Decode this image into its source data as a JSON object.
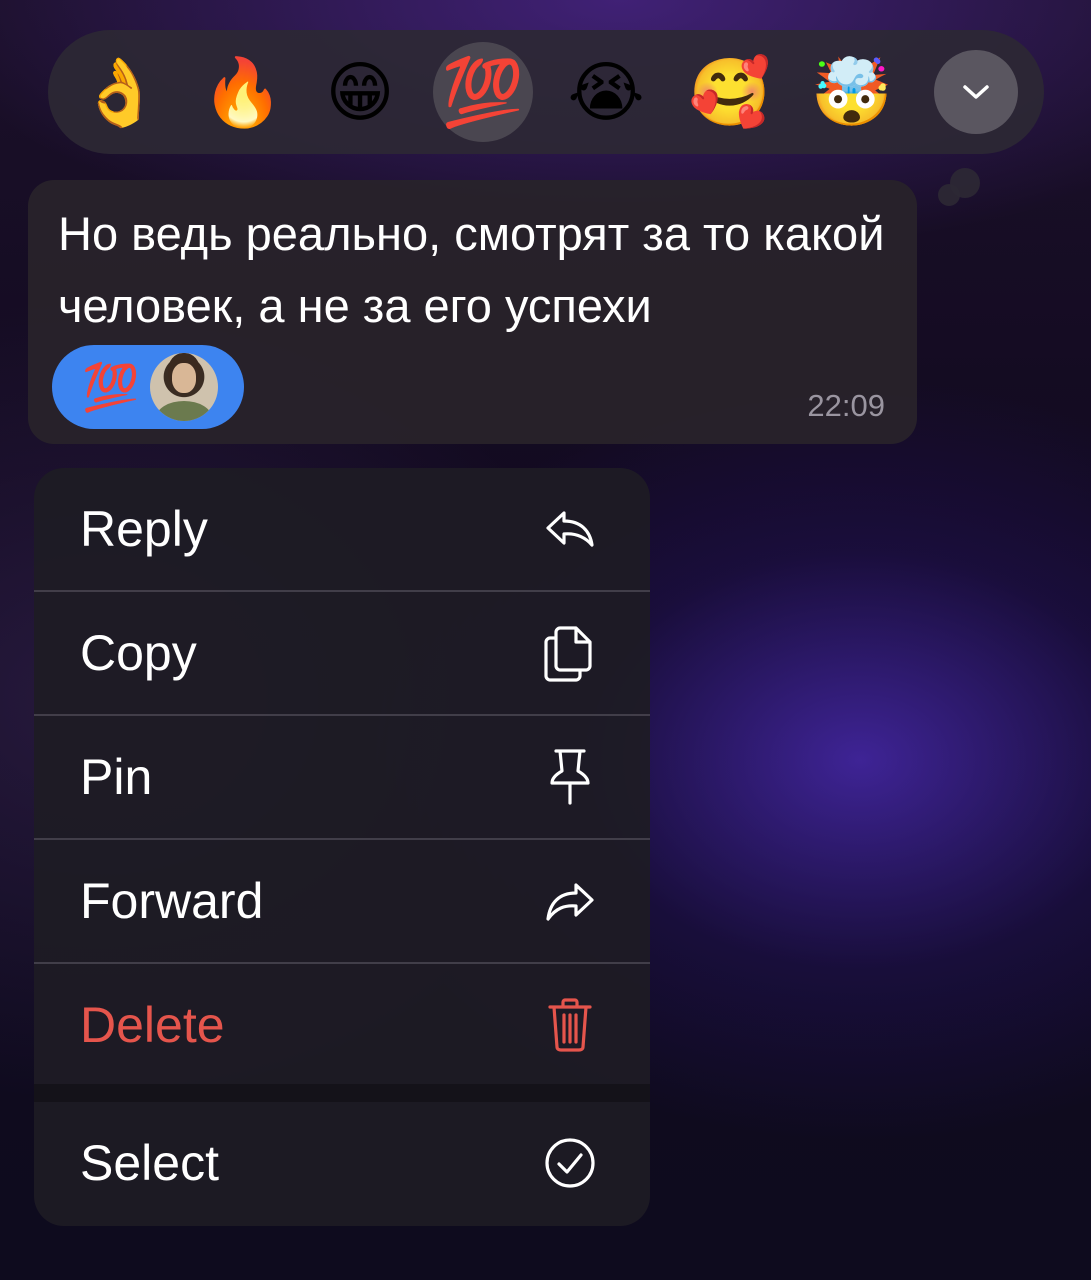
{
  "reactions": {
    "items": [
      {
        "emoji": "👌",
        "name": "ok-hand"
      },
      {
        "emoji": "🔥",
        "name": "fire"
      },
      {
        "emoji": "😁",
        "name": "grin"
      },
      {
        "emoji": "💯",
        "name": "hundred-points",
        "selected": true
      },
      {
        "emoji": "😭",
        "name": "loudly-crying"
      },
      {
        "emoji": "🥰",
        "name": "smiling-hearts"
      },
      {
        "emoji": "🤯",
        "name": "exploding-head"
      }
    ],
    "expand_icon": "chevron-down-icon"
  },
  "message": {
    "text": "Но ведь реально, смотрят за то какой человек, а не за его успехи",
    "reaction_emoji": "💯",
    "time": "22:09"
  },
  "menu": {
    "items": [
      {
        "label": "Reply",
        "icon": "reply-icon"
      },
      {
        "label": "Copy",
        "icon": "copy-icon"
      },
      {
        "label": "Pin",
        "icon": "pin-icon"
      },
      {
        "label": "Forward",
        "icon": "forward-icon"
      },
      {
        "label": "Delete",
        "icon": "trash-icon",
        "danger": true
      },
      {
        "label": "Select",
        "icon": "checkmark-circle-icon"
      }
    ]
  },
  "colors": {
    "danger": "#e5554c",
    "reaction_pill": "#3d84f0"
  }
}
